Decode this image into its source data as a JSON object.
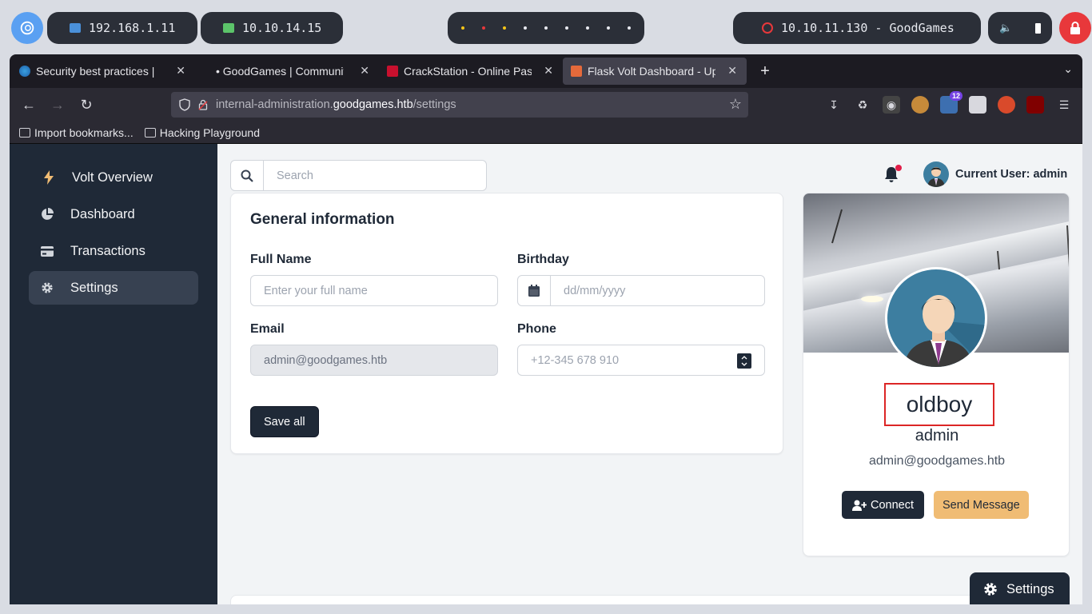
{
  "system_bar": {
    "ip_local": "192.168.1.11",
    "ip_vpn": "10.10.14.15",
    "target": "10.10.11.130 - GoodGames",
    "colors": {
      "bar_bg": "#2b2f38",
      "lock_bg": "#e8383b",
      "debian_bg": "#5aa0f2"
    }
  },
  "browser": {
    "tabs": [
      {
        "title": "Security best practices |",
        "icon": "edge-icon",
        "active": false
      },
      {
        "title": "• GoodGames | Communit",
        "icon": "none",
        "active": false
      },
      {
        "title": "CrackStation - Online Pas",
        "icon": "crackstation-icon",
        "active": false
      },
      {
        "title": "Flask Volt Dashboard - Up",
        "icon": "flask-icon",
        "active": true
      }
    ],
    "url": {
      "prefix": "internal-administration.",
      "domain": "goodgames.htb",
      "path": "/settings"
    },
    "extension_badge": "12",
    "bookmarks": [
      {
        "label": "Import bookmarks...",
        "icon": "import-icon"
      },
      {
        "label": "Hacking Playground",
        "icon": "folder-icon"
      }
    ]
  },
  "sidebar": {
    "items": [
      {
        "label": "Volt Overview",
        "icon": "bolt-icon",
        "active": false
      },
      {
        "label": "Dashboard",
        "icon": "pie-chart-icon",
        "active": false
      },
      {
        "label": "Transactions",
        "icon": "credit-card-icon",
        "active": false
      },
      {
        "label": "Settings",
        "icon": "gear-icon",
        "active": true
      }
    ]
  },
  "topbar": {
    "search_placeholder": "Search",
    "current_user": "Current User: admin"
  },
  "general_info": {
    "title": "General information",
    "full_name_label": "Full Name",
    "full_name_placeholder": "Enter your full name",
    "birthday_label": "Birthday",
    "birthday_placeholder": "dd/mm/yyyy",
    "email_label": "Email",
    "email_value": "admin@goodgames.htb",
    "phone_label": "Phone",
    "phone_placeholder": "+12-345 678 910",
    "save_label": "Save all"
  },
  "profile": {
    "name": "oldboy",
    "role": "admin",
    "email": "admin@goodgames.htb",
    "connect_label": "Connect",
    "message_label": "Send Message"
  },
  "settings_fab": {
    "label": "Settings"
  }
}
